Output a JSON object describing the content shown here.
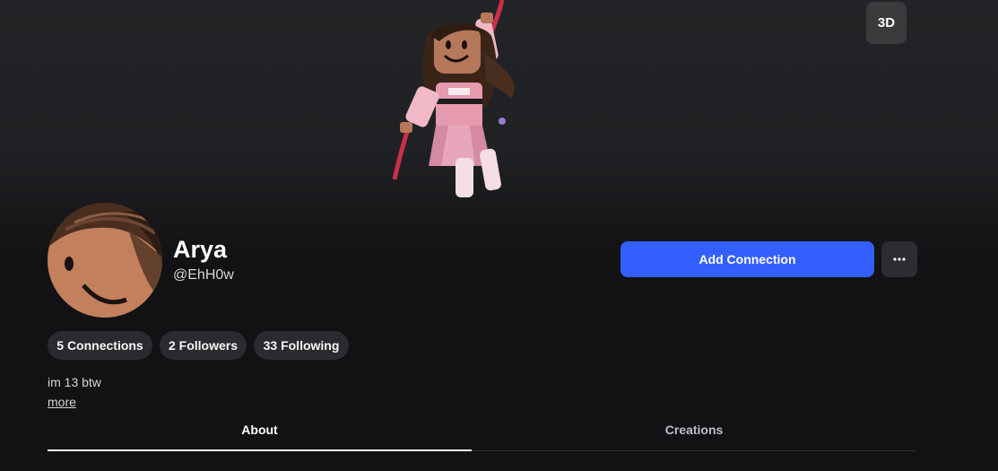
{
  "hero": {
    "view_mode_label": "3D"
  },
  "profile": {
    "display_name": "Arya",
    "username": "@EhH0w",
    "bio": "im 13 btw",
    "more_label": "more"
  },
  "actions": {
    "add_connection_label": "Add Connection",
    "more_options_icon": "ellipsis-icon"
  },
  "stats": {
    "connections": "5 Connections",
    "followers": "2 Followers",
    "following": "33 Following"
  },
  "tabs": [
    {
      "label": "About",
      "active": true
    },
    {
      "label": "Creations",
      "active": false
    }
  ],
  "colors": {
    "accent": "#335fff",
    "background": "#121215",
    "pill_bg": "#2a2b2f"
  }
}
